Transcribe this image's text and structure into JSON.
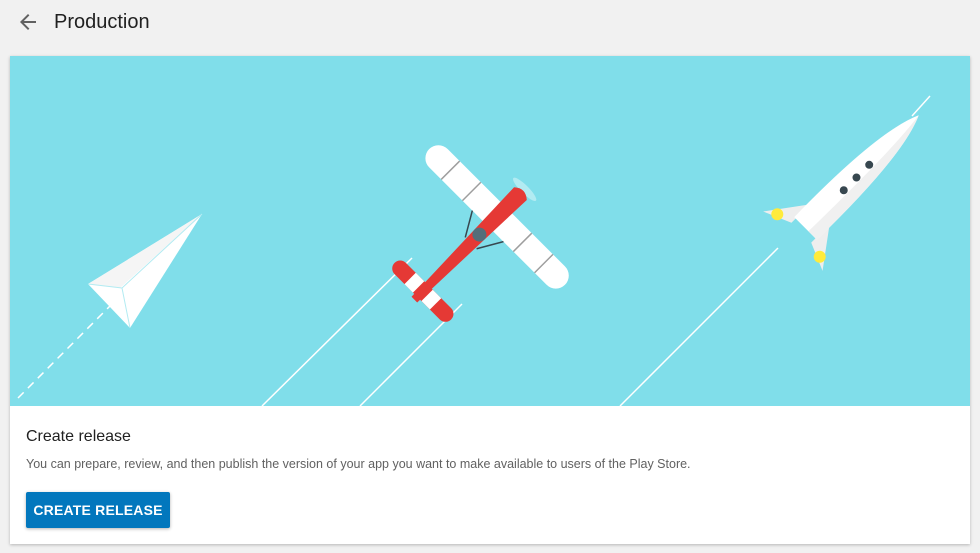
{
  "header": {
    "title": "Production"
  },
  "card": {
    "title": "Create release",
    "description": "You can prepare, review, and then publish the version of your app you want to make available to users of the Play Store.",
    "button_label": "CREATE RELEASE"
  },
  "colors": {
    "hero_background": "#80deea",
    "primary_button": "#0277bd",
    "plane_red": "#e53935",
    "rocket_window": "#37474f",
    "rocket_flame": "#ffeb3b"
  },
  "icons": {
    "back": "arrow-back-icon"
  }
}
